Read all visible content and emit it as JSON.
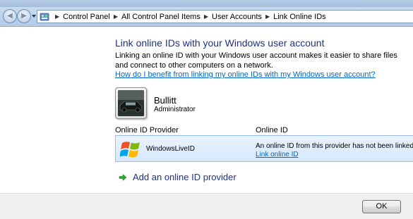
{
  "window": {
    "title": ""
  },
  "address_bar": {
    "icon": "control-panel-icon",
    "breadcrumbs": [
      "Control Panel",
      "All Control Panel Items",
      "User Accounts",
      "Link Online IDs"
    ]
  },
  "main": {
    "heading": "Link online IDs with your Windows user account",
    "description": "Linking an online ID with your Windows user account makes it easier to share files and connect to other computers on a network.",
    "help_link": "How do I benefit from linking my online IDs with my Windows user account?"
  },
  "user": {
    "name": "Bullitt",
    "role": "Administrator",
    "avatar_icon": "car-picture-icon"
  },
  "table": {
    "columns": [
      "Online ID Provider",
      "Online ID"
    ],
    "rows": [
      {
        "provider": "WindowsLiveID",
        "provider_icon": "windows-logo-icon",
        "status": "An online ID from this provider has not been linked",
        "action": "Link online ID"
      }
    ]
  },
  "add_provider": {
    "label": "Add an online ID provider",
    "icon": "green-arrow-icon"
  },
  "footer": {
    "ok_label": "OK"
  },
  "colors": {
    "heading": "#1e3287",
    "link": "#0066cc",
    "selected_row": "#d6e8fb"
  }
}
